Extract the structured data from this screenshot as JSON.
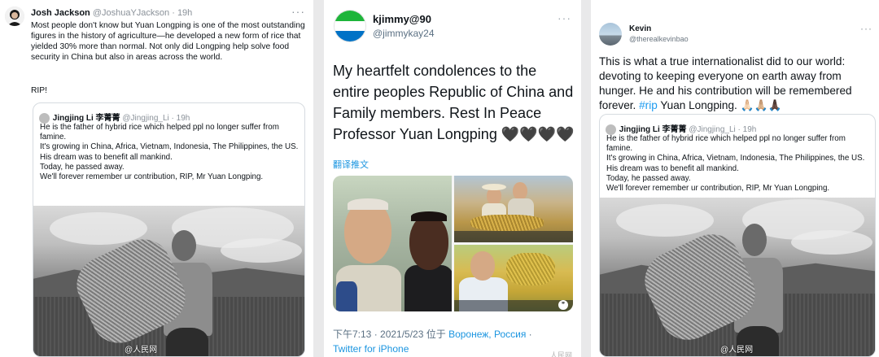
{
  "panel1": {
    "author_name": "Josh Jackson",
    "author_handle": "@JoshuaYJackson",
    "time": "· 19h",
    "more_icon": "more-icon",
    "body": "Most people don't know but Yuan Longping is one of the most outstanding figures in the history of agriculture—he developed a new form of rice that yielded 30% more than normal.  Not only did Longping help solve food security in China but also in areas across the world.",
    "rip": "RIP!",
    "quote": {
      "author_name": "Jingjing Li 李菁菁",
      "author_handle": "@Jingjing_Li",
      "time": "· 19h",
      "lines": [
        "He is the father of hybrid rice which helped ppl no longer suffer from famine.",
        "It's growing in China, Africa, Vietnam, Indonesia, The Philippines, the US.",
        "His dream was to benefit all mankind.",
        "Today, he passed away.",
        "We'll forever remember ur contribution, RIP, Mr Yuan Longping."
      ]
    },
    "watermark": "@人民网"
  },
  "panel2": {
    "author_name": "kjimmy@90",
    "author_handle": "@jimmykay24",
    "body": "My heartfelt condolences to the entire peoples Republic of China and Family members. Rest In Peace Professor Yuan Longping 🖤🖤🖤🖤",
    "translate": "翻译推文",
    "footer_time": "下午7:13 · 2021/5/23 位于 ",
    "footer_location": "Воронеж, Россия",
    "footer_sep": " ·",
    "footer_client": "Twitter for iPhone",
    "watermark": "人民网"
  },
  "panel3": {
    "author_name": "Kevin",
    "author_handle": "@therealkevinbao",
    "body_start": "This is what a true internationalist did to our world: devoting to keeping everyone on earth away from hunger. He and his contribution will be remembered forever. ",
    "hashtag": "#rip",
    "body_end": " Yuan Longping. 🙏🏻🙏🏼🙏🏿",
    "quote": {
      "author_name": "Jingjing Li 李菁菁",
      "author_handle": "@Jingjing_Li",
      "time": "· 19h",
      "lines": [
        "He is the father of hybrid rice which helped ppl no longer suffer from famine.",
        "It's growing in China, Africa, Vietnam, Indonesia, The Philippines, the US.",
        "His dream was to benefit all mankind.",
        "Today, he passed away.",
        "We'll forever remember ur contribution, RIP, Mr Yuan Longping."
      ]
    },
    "watermark": "@人民网"
  },
  "colors": {
    "link": "#1b95e0",
    "muted": "#8a9199",
    "text": "#0f1419"
  }
}
